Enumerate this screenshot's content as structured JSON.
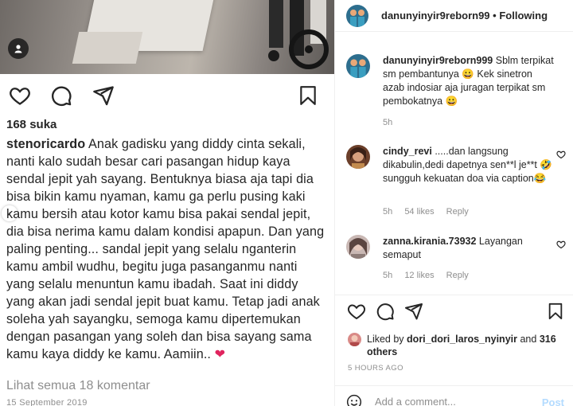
{
  "post": {
    "likes": "168 suka",
    "caption_user": "stenoricardo",
    "caption_text": "Anak gadisku yang diddy cinta sekali, nanti kalo sudah besar cari pasangan hidup kaya sendal jepit yah sayang. Bentuknya biasa aja tapi dia bisa bikin kamu nyaman, kamu ga perlu pusing kaki kamu bersih atau kotor kamu bisa pakai sendal jepit, dia bisa nerima kamu dalam kondisi apapun. Dan yang paling penting... sandal jepit yang selalu nganterin kamu ambil wudhu, begitu juga pasanganmu nanti yang selalu menuntun kamu ibadah. Saat ini diddy yang akan jadi sendal jepit buat kamu. Tetap jadi anak soleha yah sayangku, semoga kamu dipertemukan dengan pasangan yang soleh dan bisa sayang sama kamu kaya diddy ke kamu. Aamiin..",
    "caption_emoji": "❤",
    "view_all": "Lihat semua 18 komentar",
    "date": "15 September 2019"
  },
  "sidebar": {
    "header": {
      "username": "danunyinyir9reborn99",
      "separator": "•",
      "follow_label": "Following"
    },
    "comments": [
      {
        "username": "danunyinyir9reborn999",
        "text": "Sblm terpikat sm pembantunya 😀 Kek sinetron azab indosiar aja juragan terpikat sm pembokatnya 😀",
        "time": "5h",
        "likes": "",
        "reply": ""
      },
      {
        "username": "cindy_revi",
        "text": ".....dan langsung dikabulin,dedi dapetnya sen**l je**t 🤣 sungguh kekuatan doa via caption😂",
        "time": "5h",
        "likes": "54 likes",
        "reply": "Reply"
      },
      {
        "username": "zanna.kirania.73932",
        "text": "Layangan semaput",
        "time": "5h",
        "likes": "12 likes",
        "reply": "Reply"
      }
    ],
    "liked_prefix": "Liked by",
    "liked_user": "dori_dori_laros_nyinyir",
    "liked_and": "and",
    "liked_others": "316 others",
    "timestamp": "5 HOURS AGO",
    "add_comment_placeholder": "Add a comment...",
    "post_label": "Post"
  },
  "colors": {
    "text": "#262626",
    "muted": "#8e8e8e",
    "post_disabled": "#b3dbff",
    "heart": "#e0245e"
  }
}
